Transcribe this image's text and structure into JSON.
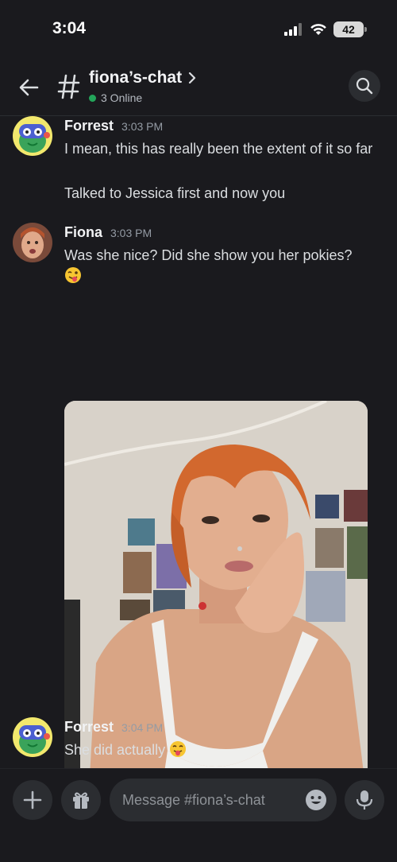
{
  "status_bar": {
    "time": "3:04",
    "battery": "42"
  },
  "header": {
    "channel_name": "fiona’s-chat",
    "online_text": "3 Online"
  },
  "messages": [
    {
      "author": "Forrest",
      "timestamp": "3:03 PM",
      "lines": [
        "I mean, this has really been the extent of it so far",
        "Talked to Jessica first and now you"
      ]
    },
    {
      "author": "Fiona",
      "timestamp": "3:03 PM",
      "lines": [
        "Was she nice? Did she show you her pokies?"
      ],
      "emoji": "winking-tongue-face"
    },
    {
      "author": "Forrest",
      "timestamp": "3:04 PM",
      "lines": [
        "She did actually"
      ],
      "emoji": "tongue-face"
    }
  ],
  "composer": {
    "placeholder": "Message #fiona’s-chat"
  },
  "colors": {
    "background": "#1a1a1e",
    "online": "#23a55a",
    "surface": "#2b2d31"
  }
}
